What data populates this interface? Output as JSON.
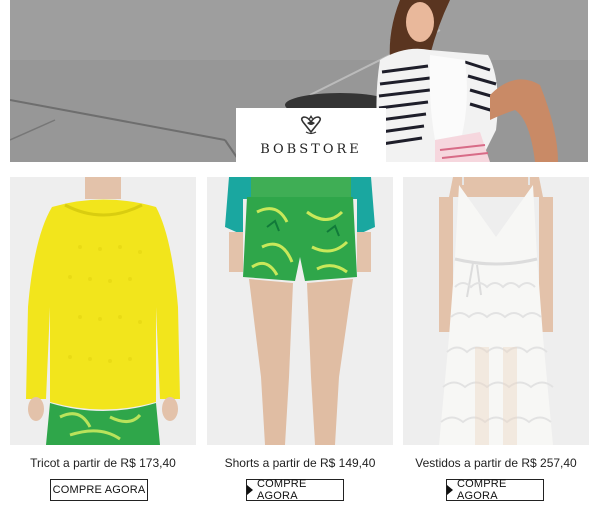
{
  "brand": {
    "name": "BOBSTORE"
  },
  "hero": {
    "alt": "campaign-photo"
  },
  "products": [
    {
      "caption": "Tricot a partir de R$ 173,40",
      "button": "COMPRE AGORA",
      "has_arrow": false,
      "color": "#f2e51c"
    },
    {
      "caption": "Shorts a partir de R$ 149,40",
      "button": "COMPRE AGORA",
      "has_arrow": true,
      "color": "#2fa64a"
    },
    {
      "caption": "Vestidos a partir de R$ 257,40",
      "button": "COMPRE AGORA",
      "has_arrow": true,
      "color": "#f4f4f2"
    }
  ],
  "colors": {
    "accent_yellow": "#f2e51c",
    "accent_green": "#2fa64a",
    "accent_teal": "#1aa7a0"
  }
}
